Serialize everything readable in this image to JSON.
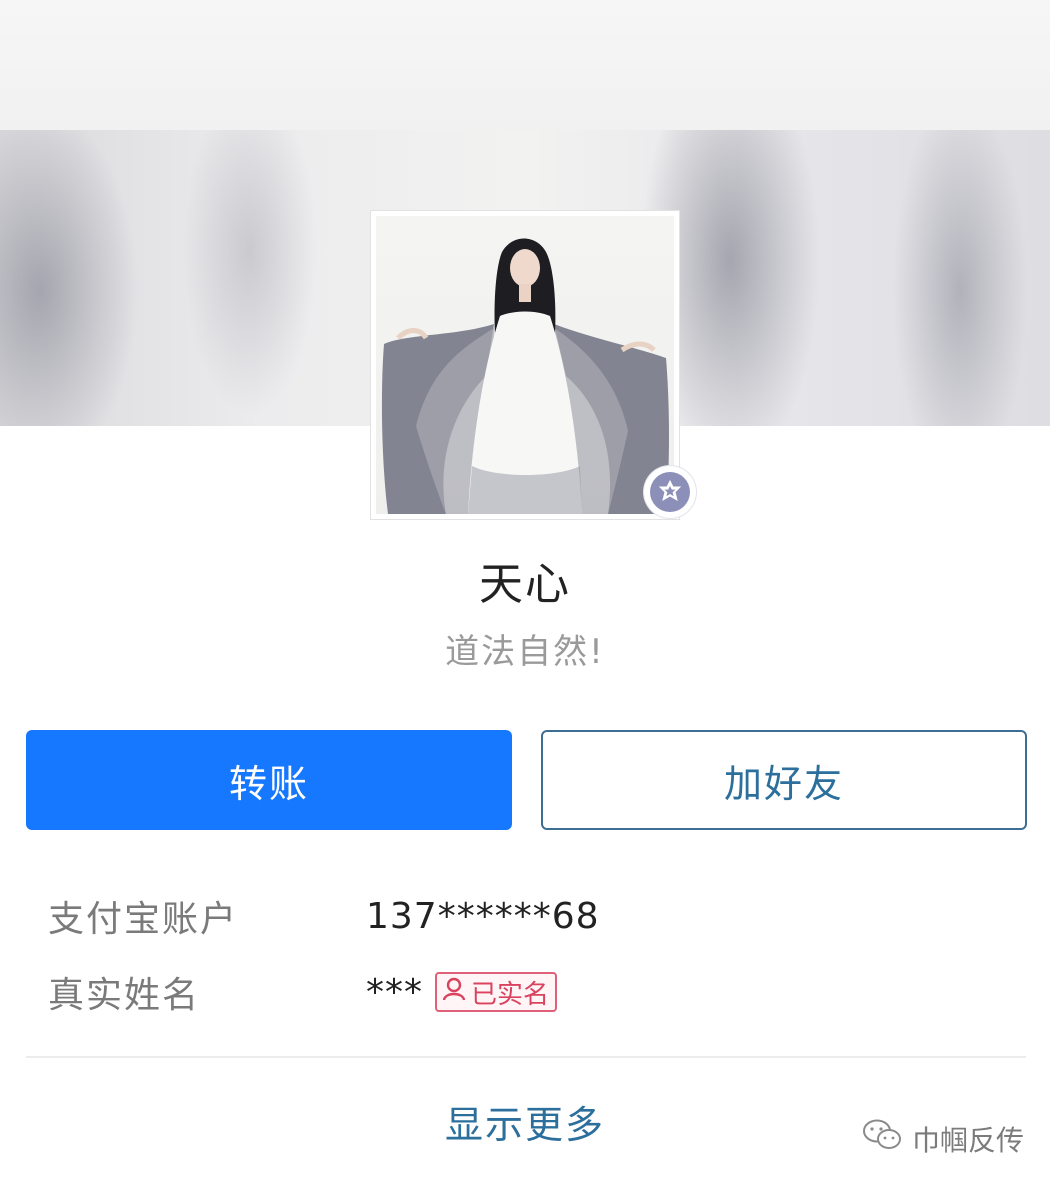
{
  "profile": {
    "name": "天心",
    "signature": "道法自然!"
  },
  "actions": {
    "transfer_label": "转账",
    "add_friend_label": "加好友"
  },
  "info": {
    "account_label": "支付宝账户",
    "account_value": "137******68",
    "realname_label": "真实姓名",
    "realname_value": "***",
    "verified_label": "已实名"
  },
  "footer": {
    "show_more_label": "显示更多"
  },
  "watermark": {
    "text": "巾帼反传",
    "icon": "wechat-icon"
  },
  "colors": {
    "primary": "#1677ff",
    "link": "#2c6f9c",
    "verified": "#d9435f"
  }
}
